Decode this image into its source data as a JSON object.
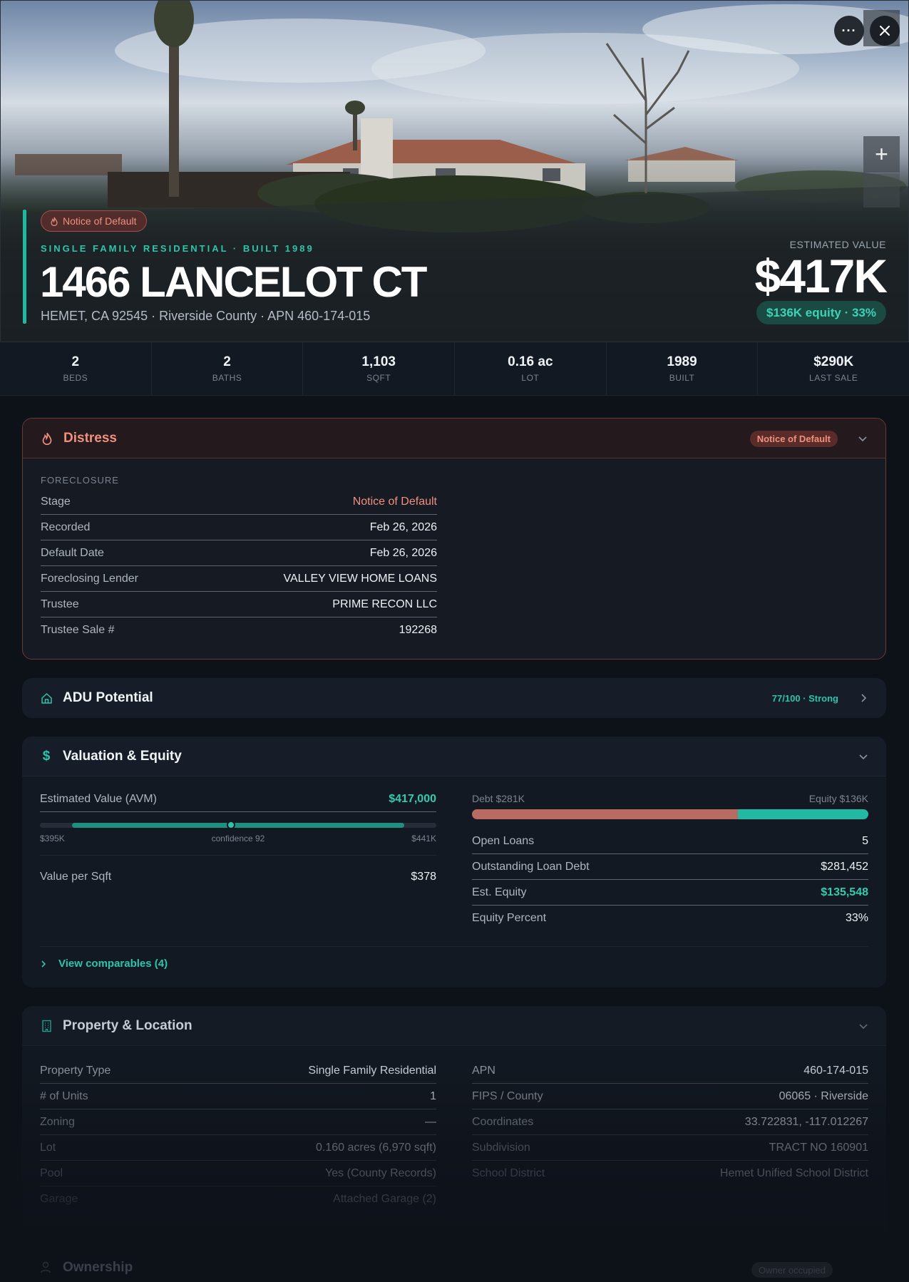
{
  "hero": {
    "badge": "Notice of Default",
    "eyebrow": "SINGLE FAMILY RESIDENTIAL · BUILT 1989",
    "address": "1466 LANCELOT CT",
    "subtitle": "HEMET, CA 92545 · Riverside County · APN 460-174-015",
    "est_label": "ESTIMATED VALUE",
    "est_value": "$417K",
    "equity_pill": "$136K equity · 33%",
    "more_icon": "ellipsis-icon",
    "close_icon": "close-icon",
    "zoom_in_label": "+"
  },
  "stats": [
    {
      "value": "2",
      "label": "BEDS"
    },
    {
      "value": "2",
      "label": "BATHS"
    },
    {
      "value": "1,103",
      "label": "SQFT"
    },
    {
      "value": "0.16 ac",
      "label": "LOT"
    },
    {
      "value": "1989",
      "label": "BUILT"
    },
    {
      "value": "$290K",
      "label": "LAST SALE"
    }
  ],
  "distress": {
    "title": "Distress",
    "badge": "Notice of Default",
    "section_label": "FORECLOSURE",
    "rows": [
      {
        "key": "Stage",
        "value": "Notice of Default"
      },
      {
        "key": "Recorded",
        "value": "Feb 26, 2026"
      },
      {
        "key": "Default Date",
        "value": "Feb 26, 2026"
      },
      {
        "key": "Foreclosing Lender",
        "value": "VALLEY VIEW HOME LOANS"
      },
      {
        "key": "Trustee",
        "value": "PRIME RECON LLC"
      },
      {
        "key": "Trustee Sale #",
        "value": "192268"
      }
    ]
  },
  "adu": {
    "title": "ADU Potential",
    "score": "77/100 · Strong"
  },
  "valuation": {
    "title": "Valuation & Equity",
    "avm_key": "Estimated Value (AVM)",
    "avm_value": "$417,000",
    "range_low": "$395K",
    "range_high": "$441K",
    "confidence": "confidence 92",
    "range": {
      "min": 395000,
      "max": 441000,
      "value": 417000
    },
    "ppsf_key": "Value per Sqft",
    "ppsf_value": "$378",
    "debt_label": "Debt $281K",
    "equity_label": "Equity $136K",
    "debt_fraction": 0.67,
    "rows": [
      {
        "key": "Open Loans",
        "value": "5"
      },
      {
        "key": "Outstanding Loan Debt",
        "value": "$281,452"
      },
      {
        "key": "Est. Equity",
        "value": "$135,548"
      },
      {
        "key": "Equity Percent",
        "value": "33%"
      }
    ],
    "comps_link": "View comparables (4)"
  },
  "property": {
    "title": "Property & Location",
    "left": [
      {
        "key": "Property Type",
        "value": "Single Family Residential"
      },
      {
        "key": "# of Units",
        "value": "1"
      },
      {
        "key": "Zoning",
        "value": "—"
      },
      {
        "key": "Lot",
        "value": "0.160 acres (6,970 sqft)"
      },
      {
        "key": "Pool",
        "value": "Yes (County Records)"
      },
      {
        "key": "Garage",
        "value": "Attached Garage (2)"
      }
    ],
    "right": [
      {
        "key": "APN",
        "value": "460-174-015"
      },
      {
        "key": "FIPS / County",
        "value": "06065 · Riverside"
      },
      {
        "key": "Coordinates",
        "value": "33.722831, -117.012267"
      },
      {
        "key": "Subdivision",
        "value": "TRACT NO 160901"
      },
      {
        "key": "School District",
        "value": "Hemet Unified School District"
      }
    ]
  },
  "ownership": {
    "title": "Ownership",
    "badge": "Owner occupied"
  },
  "colors": {
    "accent": "#1fb8a1",
    "distress": "#f0907e",
    "debt": "#b96b62",
    "equity": "#22b9a3"
  }
}
